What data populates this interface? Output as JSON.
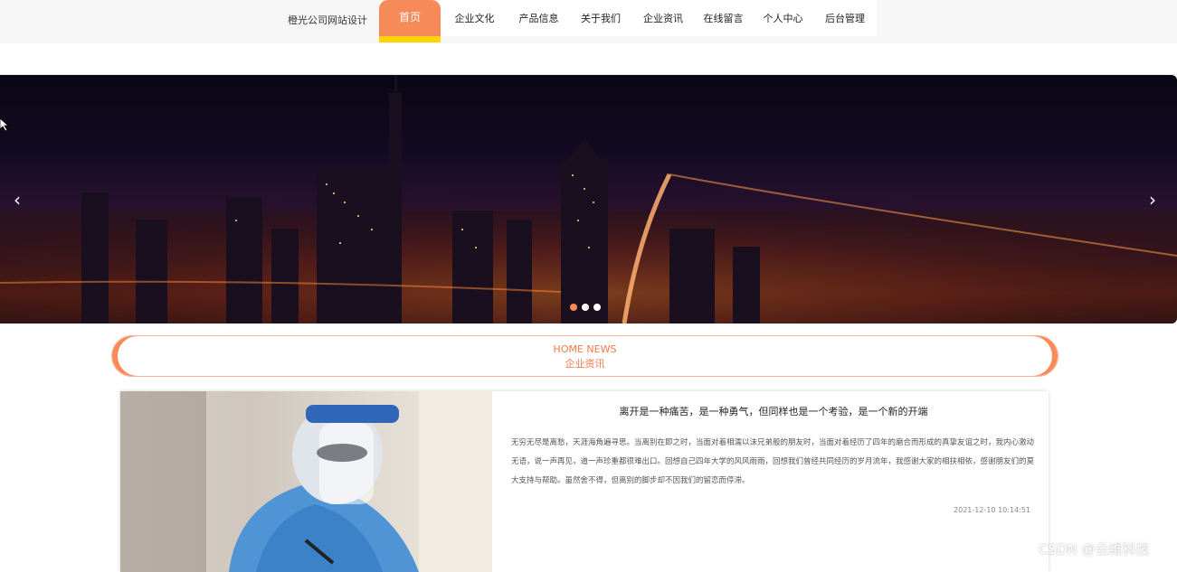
{
  "header": {
    "brand": "橙光公司网站设计",
    "nav": [
      {
        "label": "首页",
        "active": true
      },
      {
        "label": "企业文化"
      },
      {
        "label": "产品信息"
      },
      {
        "label": "关于我们"
      },
      {
        "label": "企业资讯"
      },
      {
        "label": "在线留言"
      },
      {
        "label": "个人中心"
      },
      {
        "label": "后台管理"
      }
    ]
  },
  "banner": {
    "prev_icon": "chevron-left-icon",
    "next_icon": "chevron-right-icon",
    "slide_count": 3,
    "active_slide": 1
  },
  "section": {
    "title_en": "HOME NEWS",
    "title_cn": "企业资讯"
  },
  "news": {
    "title": "离开是一种痛苦，是一种勇气，但同样也是一个考验，是一个新的开端",
    "body": "无穷无尽是离愁，天涯海角遍寻思。当离别在即之时，当面对着相濡以沫兄弟般的朋友时，当面对着经历了四年的磨合而形成的真挚友谊之时，我内心激动无语，说一声再见，道一声珍重都很难出口。回想自己四年大学的风风雨雨，回想我们曾经共同经历的岁月流年，我感谢大家的相扶相依，感谢朋友们的莫大支持与帮助。虽然舍不得，但离别的脚步却不因我们的留恋而停滞。",
    "date": "2021-12-10 10:14:51"
  },
  "watermark": "CSDN @云维科技",
  "colors": {
    "accent": "#f78a59",
    "active_underline": "#ffd400",
    "section_text": "#f07a48"
  }
}
